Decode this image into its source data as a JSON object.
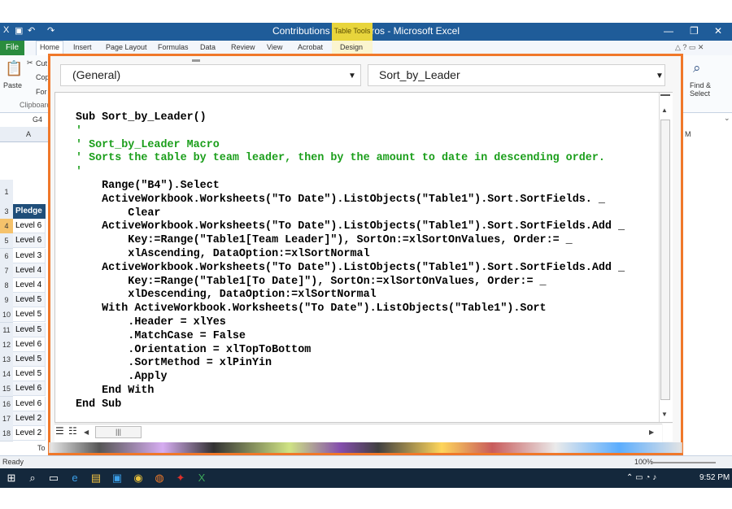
{
  "excel": {
    "window_title": "Contributions with Macros - Microsoft Excel",
    "table_tools_label": "Table Tools",
    "file_tab": "File",
    "tabs": [
      "Home",
      "Insert",
      "Page Layout",
      "Formulas",
      "Data",
      "Review",
      "View",
      "Acrobat",
      "Design"
    ],
    "ribbon": {
      "cut": "Cut",
      "copy": "Cop",
      "format": "For",
      "paste": "Paste",
      "clipboard": "Clipboard",
      "find_select_1": "Find &",
      "find_select_2": "Select"
    },
    "name_box": "G4",
    "column_a": "A",
    "column_m": "M",
    "pledge_header": "Pledge",
    "rows": [
      {
        "num": "3",
        "val": ""
      },
      {
        "num": "4",
        "val": "Level 6"
      },
      {
        "num": "5",
        "val": "Level 6"
      },
      {
        "num": "6",
        "val": "Level 3"
      },
      {
        "num": "7",
        "val": "Level 4"
      },
      {
        "num": "8",
        "val": "Level 4"
      },
      {
        "num": "9",
        "val": "Level 5"
      },
      {
        "num": "10",
        "val": "Level 5"
      },
      {
        "num": "11",
        "val": "Level 5"
      },
      {
        "num": "12",
        "val": "Level 6"
      },
      {
        "num": "13",
        "val": "Level 5"
      },
      {
        "num": "14",
        "val": "Level 5"
      },
      {
        "num": "15",
        "val": "Level 6"
      },
      {
        "num": "16",
        "val": "Level 6"
      },
      {
        "num": "17",
        "val": "Level 2"
      },
      {
        "num": "18",
        "val": "Level 2"
      }
    ],
    "sheet_tab_partial": "To",
    "status_ready": "Ready",
    "zoom": "100%"
  },
  "vba": {
    "object_combo": "(General)",
    "procedure_combo": "Sort_by_Leader",
    "code_lines": [
      {
        "text": "Sub Sort_by_Leader()",
        "comment": false
      },
      {
        "text": "'",
        "comment": true
      },
      {
        "text": "' Sort_by_Leader Macro",
        "comment": true
      },
      {
        "text": "' Sorts the table by team leader, then by the amount to date in descending order.",
        "comment": true
      },
      {
        "text": "'",
        "comment": true
      },
      {
        "text": "    Range(\"B4\").Select",
        "comment": false
      },
      {
        "text": "    ActiveWorkbook.Worksheets(\"To Date\").ListObjects(\"Table1\").Sort.SortFields. _",
        "comment": false
      },
      {
        "text": "        Clear",
        "comment": false
      },
      {
        "text": "    ActiveWorkbook.Worksheets(\"To Date\").ListObjects(\"Table1\").Sort.SortFields.Add _",
        "comment": false
      },
      {
        "text": "        Key:=Range(\"Table1[Team Leader]\"), SortOn:=xlSortOnValues, Order:= _",
        "comment": false
      },
      {
        "text": "        xlAscending, DataOption:=xlSortNormal",
        "comment": false
      },
      {
        "text": "    ActiveWorkbook.Worksheets(\"To Date\").ListObjects(\"Table1\").Sort.SortFields.Add _",
        "comment": false
      },
      {
        "text": "        Key:=Range(\"Table1[To Date]\"), SortOn:=xlSortOnValues, Order:= _",
        "comment": false
      },
      {
        "text": "        xlDescending, DataOption:=xlSortNormal",
        "comment": false
      },
      {
        "text": "    With ActiveWorkbook.Worksheets(\"To Date\").ListObjects(\"Table1\").Sort",
        "comment": false
      },
      {
        "text": "        .Header = xlYes",
        "comment": false
      },
      {
        "text": "        .MatchCase = False",
        "comment": false
      },
      {
        "text": "        .Orientation = xlTopToBottom",
        "comment": false
      },
      {
        "text": "        .SortMethod = xlPinYin",
        "comment": false
      },
      {
        "text": "        .Apply",
        "comment": false
      },
      {
        "text": "    End With",
        "comment": false
      },
      {
        "text": "End Sub",
        "comment": false
      }
    ]
  },
  "taskbar": {
    "time": "9:52 PM",
    "icons": [
      "windows-start-icon",
      "search-icon",
      "task-view-icon",
      "edge-icon",
      "file-explorer-icon",
      "store-icon",
      "chrome-icon",
      "firefox-icon",
      "acrobat-icon",
      "excel-icon"
    ]
  },
  "colors": {
    "accent_orange": "#f0782a",
    "comment_green": "#1a9e1a",
    "excel_green": "#2a8c3e",
    "table_header": "#1f4e79"
  }
}
